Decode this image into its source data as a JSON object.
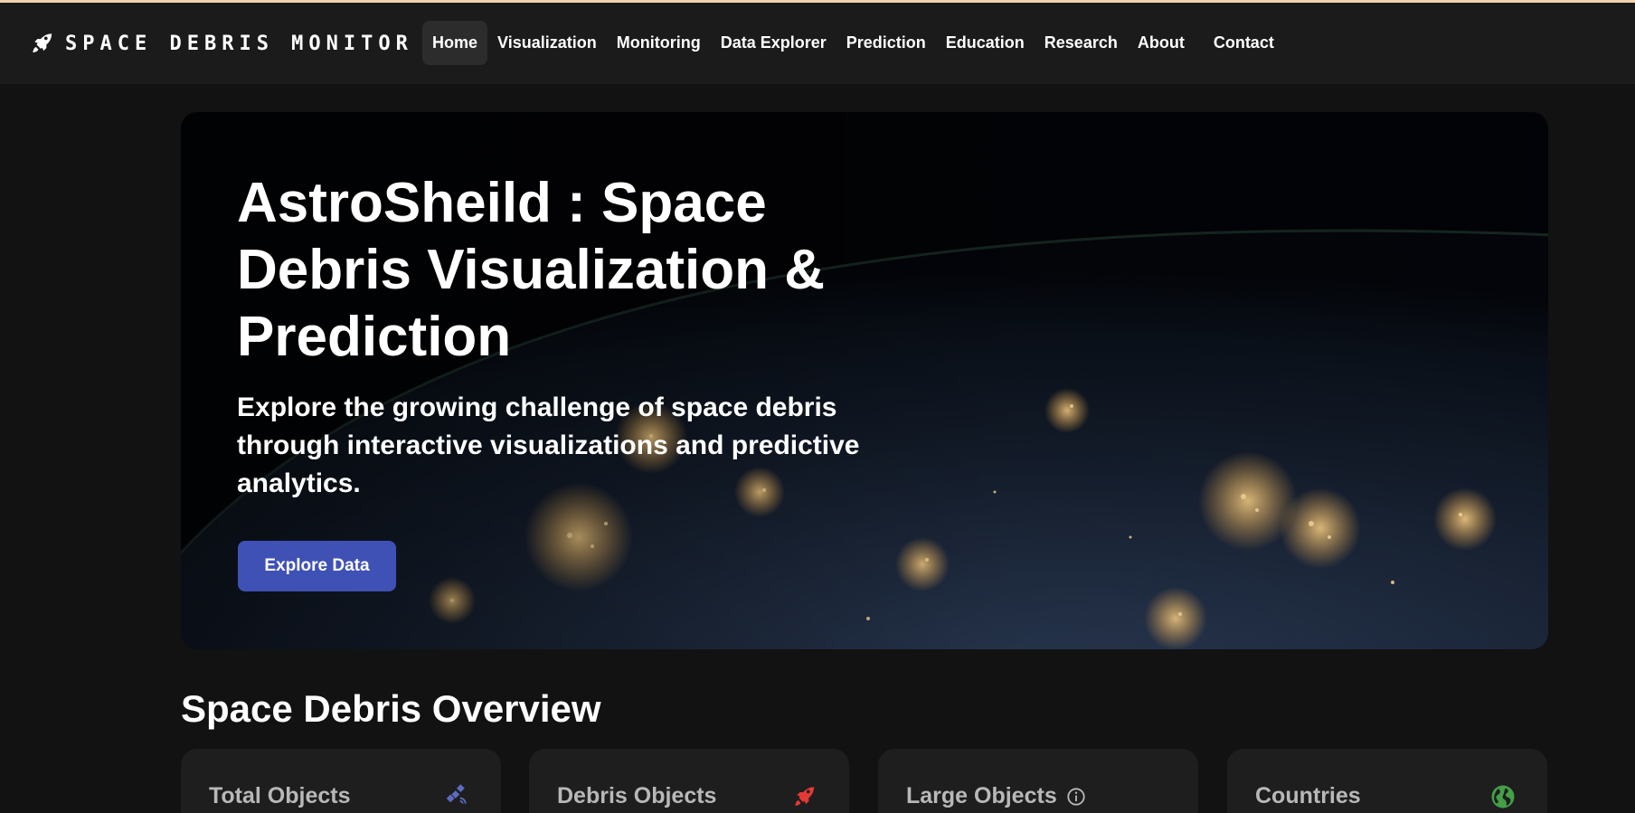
{
  "brand": {
    "name": "SPACE DEBRIS MONITOR",
    "icon": "rocket-icon"
  },
  "nav": {
    "items": [
      {
        "label": "Home",
        "active": true
      },
      {
        "label": "Visualization"
      },
      {
        "label": "Monitoring"
      },
      {
        "label": "Data Explorer"
      },
      {
        "label": "Prediction"
      },
      {
        "label": "Education"
      },
      {
        "label": "Research"
      },
      {
        "label": "About"
      },
      {
        "label": "Contact"
      }
    ]
  },
  "hero": {
    "title": "AstroSheild : Space Debris Visualization & Prediction",
    "subtitle": "Explore the growing challenge of space debris through interactive visualizations and predictive analytics.",
    "cta_label": "Explore Data"
  },
  "overview": {
    "title": "Space Debris Overview",
    "cards": [
      {
        "label": "Total Objects",
        "icon": "satellite-icon",
        "icon_color": "#5c6bc0"
      },
      {
        "label": "Debris Objects",
        "icon": "rocket-icon",
        "icon_color": "#e53935"
      },
      {
        "label": "Large Objects",
        "icon": "info-icon",
        "icon_color": "#b8b8b8"
      },
      {
        "label": "Countries",
        "icon": "globe-icon",
        "icon_color": "#43a047"
      }
    ]
  },
  "colors": {
    "accent": "#3f51b5",
    "background": "#121212",
    "navbar": "#1b1b1b",
    "card": "#1e1e1e",
    "top_strip": "#f3d3b0"
  }
}
